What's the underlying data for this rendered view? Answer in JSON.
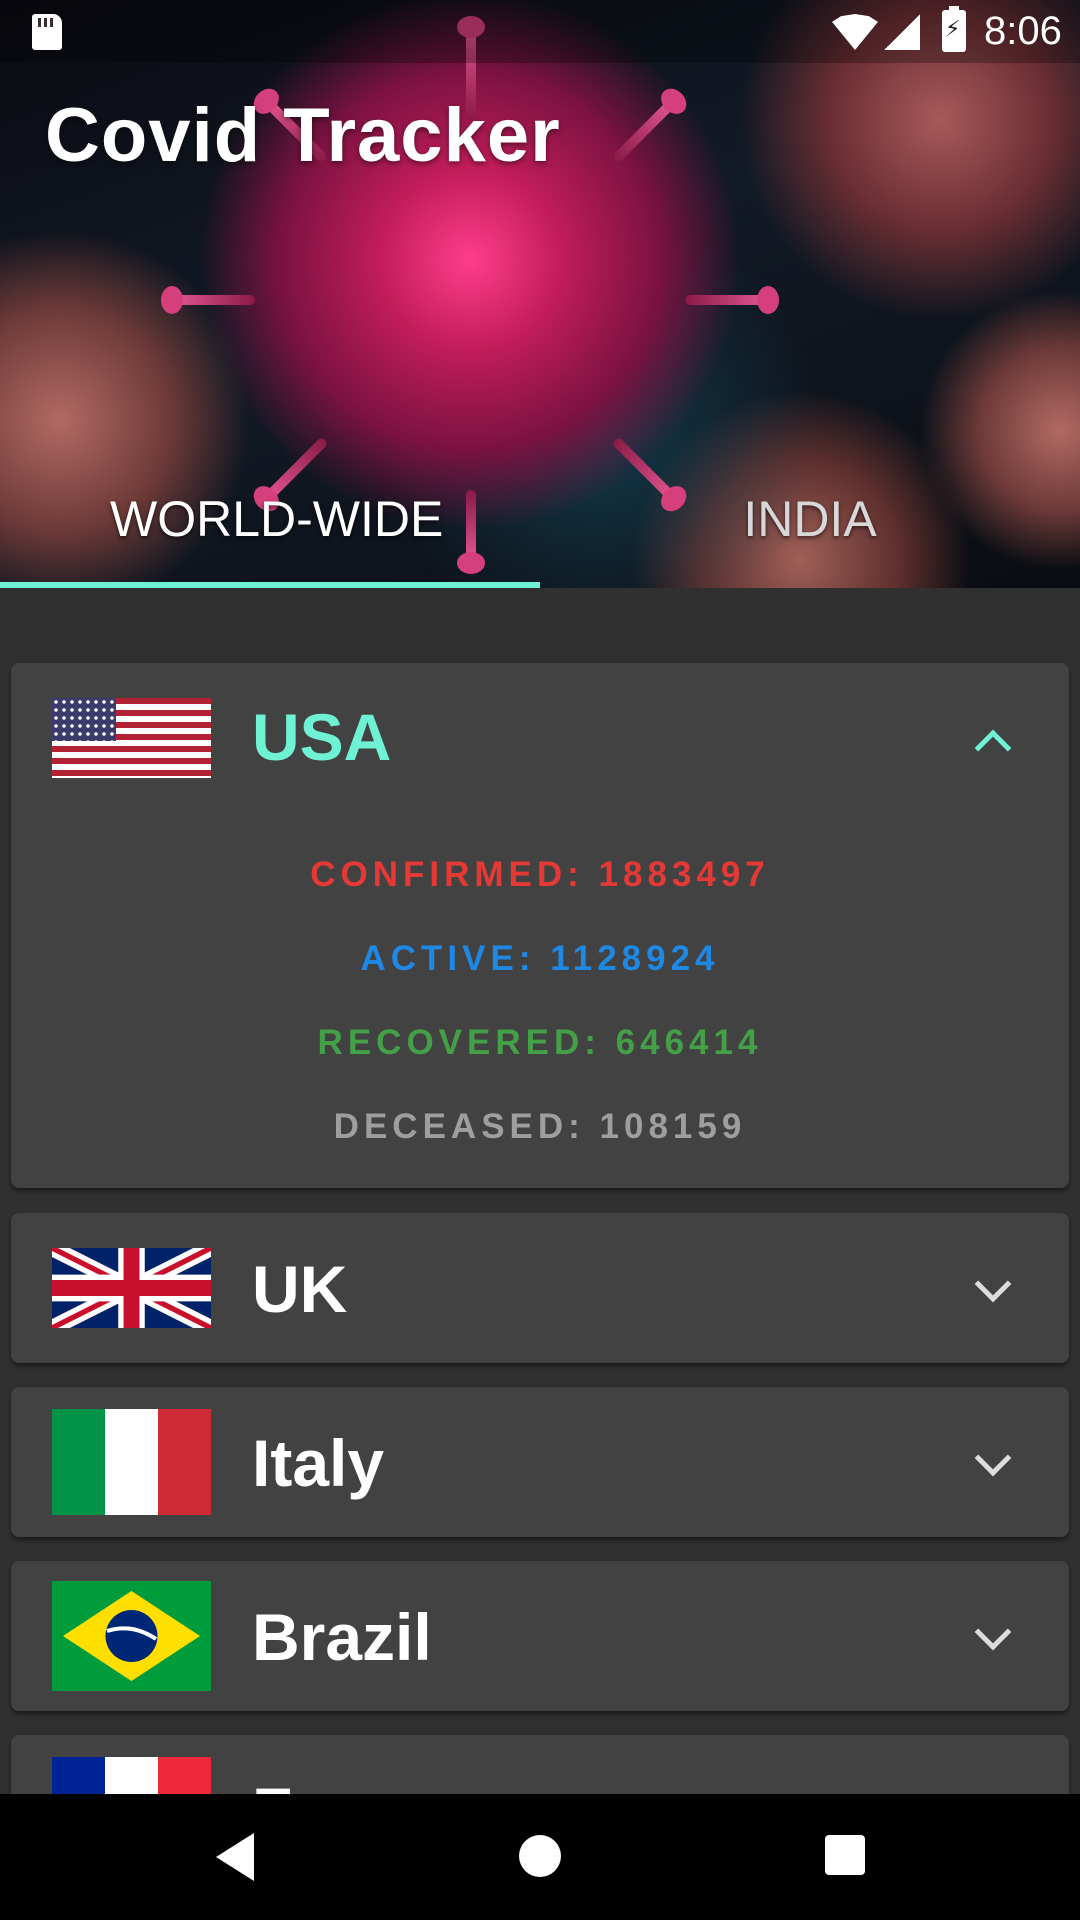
{
  "status_bar": {
    "time": "8:06",
    "icons": [
      "sd-card-icon",
      "wifi-icon",
      "signal-icon",
      "battery-charging-icon"
    ]
  },
  "app": {
    "title": "Covid Tracker"
  },
  "tabs": [
    {
      "label": "WORLD-WIDE",
      "selected": true
    },
    {
      "label": "INDIA",
      "selected": false
    }
  ],
  "colors": {
    "accent": "#6ff1d4",
    "confirmed": "#e53935",
    "active": "#1e88e5",
    "recovered": "#43a047",
    "deceased": "#9e9e9e",
    "card_background": "#424242",
    "page_background": "#303030"
  },
  "countries": [
    {
      "name": "USA",
      "flag": "usa-flag",
      "expanded": true,
      "stats": {
        "confirmed": "CONFIRMED: 1883497",
        "active": "ACTIVE: 1128924",
        "recovered": "RECOVERED: 646414",
        "deceased": "DECEASED: 108159"
      }
    },
    {
      "name": "UK",
      "flag": "uk-flag",
      "expanded": false
    },
    {
      "name": "Italy",
      "flag": "italy-flag",
      "expanded": false
    },
    {
      "name": "Brazil",
      "flag": "brazil-flag",
      "expanded": false
    },
    {
      "name": "France",
      "flag": "france-flag",
      "expanded": false
    }
  ],
  "nav_bar": {
    "buttons": [
      "back-icon",
      "home-icon",
      "recents-icon"
    ]
  }
}
